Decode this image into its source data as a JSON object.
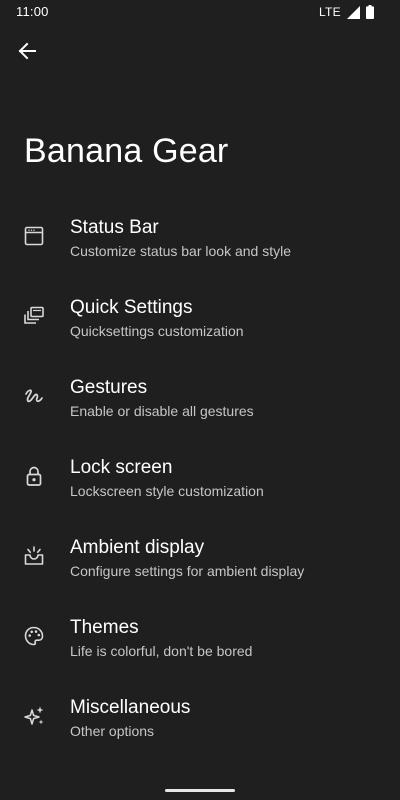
{
  "status_bar": {
    "time": "11:00",
    "network": "LTE"
  },
  "header": {
    "back_icon": "arrow-back-icon",
    "title": "Banana Gear"
  },
  "settings": [
    {
      "icon": "status-bar-icon",
      "title": "Status Bar",
      "summary": "Customize status bar look and style"
    },
    {
      "icon": "quick-settings-icon",
      "title": "Quick Settings",
      "summary": "Quicksettings customization"
    },
    {
      "icon": "gesture-icon",
      "title": "Gestures",
      "summary": "Enable or disable all gestures"
    },
    {
      "icon": "lock-icon",
      "title": "Lock screen",
      "summary": "Lockscreen style customization"
    },
    {
      "icon": "ambient-display-icon",
      "title": "Ambient display",
      "summary": "Configure settings for ambient display"
    },
    {
      "icon": "palette-icon",
      "title": "Themes",
      "summary": "Life is colorful, don't be bored"
    },
    {
      "icon": "sparkle-icon",
      "title": "Miscellaneous",
      "summary": "Other options"
    }
  ],
  "colors": {
    "background": "#1f1f1f",
    "text_primary": "#ffffff",
    "text_secondary": "#c6c6c6",
    "icon": "#d9d9d9"
  }
}
